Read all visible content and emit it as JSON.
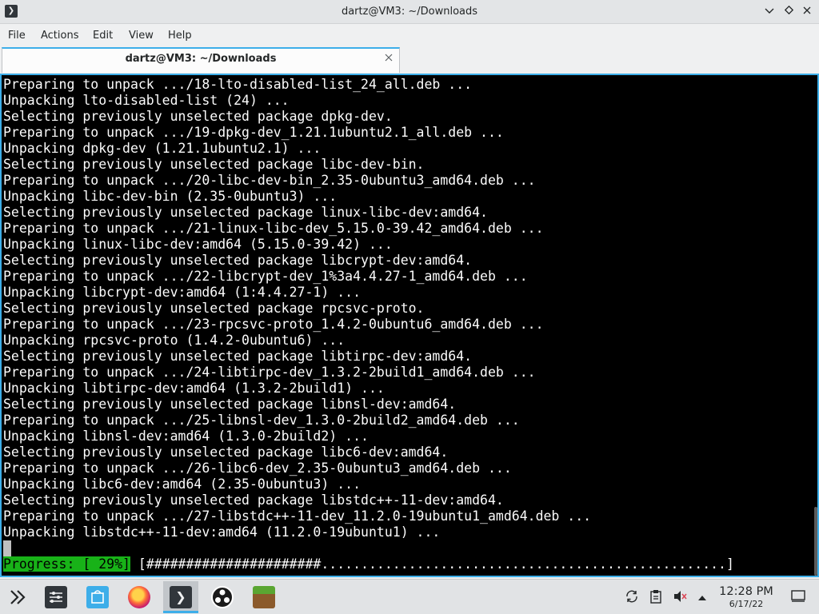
{
  "window": {
    "title": "dartz@VM3: ~/Downloads",
    "app_icon": "terminal-icon",
    "controls": [
      "chevron-down-icon",
      "diamond-icon",
      "close-icon"
    ]
  },
  "menu": {
    "items": [
      "File",
      "Actions",
      "Edit",
      "View",
      "Help"
    ]
  },
  "tab": {
    "label": "dartz@VM3: ~/Downloads",
    "close_icon": "close-icon"
  },
  "terminal": {
    "lines": [
      "Preparing to unpack .../18-lto-disabled-list_24_all.deb ...",
      "Unpacking lto-disabled-list (24) ...",
      "Selecting previously unselected package dpkg-dev.",
      "Preparing to unpack .../19-dpkg-dev_1.21.1ubuntu2.1_all.deb ...",
      "Unpacking dpkg-dev (1.21.1ubuntu2.1) ...",
      "Selecting previously unselected package libc-dev-bin.",
      "Preparing to unpack .../20-libc-dev-bin_2.35-0ubuntu3_amd64.deb ...",
      "Unpacking libc-dev-bin (2.35-0ubuntu3) ...",
      "Selecting previously unselected package linux-libc-dev:amd64.",
      "Preparing to unpack .../21-linux-libc-dev_5.15.0-39.42_amd64.deb ...",
      "Unpacking linux-libc-dev:amd64 (5.15.0-39.42) ...",
      "Selecting previously unselected package libcrypt-dev:amd64.",
      "Preparing to unpack .../22-libcrypt-dev_1%3a4.4.27-1_amd64.deb ...",
      "Unpacking libcrypt-dev:amd64 (1:4.4.27-1) ...",
      "Selecting previously unselected package rpcsvc-proto.",
      "Preparing to unpack .../23-rpcsvc-proto_1.4.2-0ubuntu6_amd64.deb ...",
      "Unpacking rpcsvc-proto (1.4.2-0ubuntu6) ...",
      "Selecting previously unselected package libtirpc-dev:amd64.",
      "Preparing to unpack .../24-libtirpc-dev_1.3.2-2build1_amd64.deb ...",
      "Unpacking libtirpc-dev:amd64 (1.3.2-2build1) ...",
      "Selecting previously unselected package libnsl-dev:amd64.",
      "Preparing to unpack .../25-libnsl-dev_1.3.0-2build2_amd64.deb ...",
      "Unpacking libnsl-dev:amd64 (1.3.0-2build2) ...",
      "Selecting previously unselected package libc6-dev:amd64.",
      "Preparing to unpack .../26-libc6-dev_2.35-0ubuntu3_amd64.deb ...",
      "Unpacking libc6-dev:amd64 (2.35-0ubuntu3) ...",
      "Selecting previously unselected package libstdc++-11-dev:amd64.",
      "Preparing to unpack .../27-libstdc++-11-dev_11.2.0-19ubuntu1_amd64.deb ...",
      "Unpacking libstdc++-11-dev:amd64 (11.2.0-19ubuntu1) ..."
    ],
    "progress_label": "Progress: [ 29%]",
    "progress_bar": " [######################...................................................] ",
    "progress_percent": 29
  },
  "taskbar": {
    "apps": [
      {
        "name": "application-launcher-icon",
        "active": false
      },
      {
        "name": "system-settings-icon",
        "active": false
      },
      {
        "name": "discover-icon",
        "active": false
      },
      {
        "name": "firefox-icon",
        "active": false
      },
      {
        "name": "konsole-icon",
        "active": true
      },
      {
        "name": "obs-studio-icon",
        "active": false
      },
      {
        "name": "minecraft-icon",
        "active": false
      }
    ],
    "tray": [
      "update-icon",
      "clipboard-icon",
      "volume-muted-icon",
      "chevron-up-icon"
    ],
    "clock_time": "12:28 PM",
    "clock_date": "6/17/22",
    "show_desktop_icon": "show-desktop-icon"
  },
  "colors": {
    "accent": "#3daee9",
    "terminal_bg": "#000000",
    "terminal_fg": "#fcfcfc",
    "progress_green": "#18b218"
  }
}
